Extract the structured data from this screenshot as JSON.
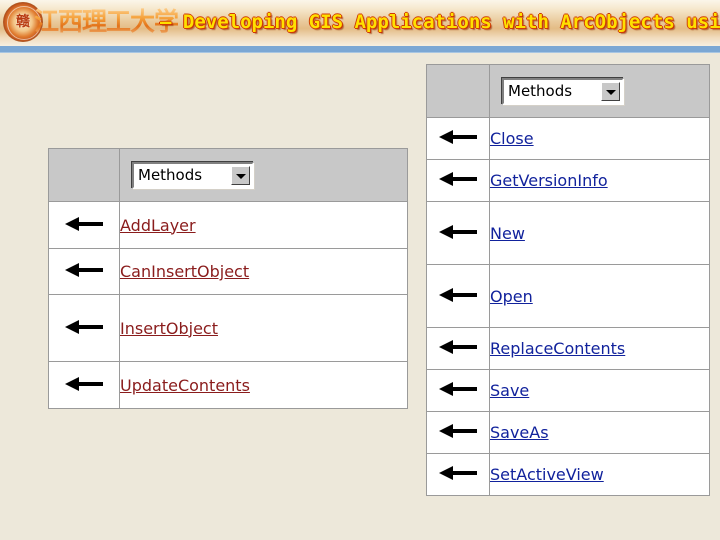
{
  "banner": {
    "logo_icon": "university-seal-icon",
    "logo_glyph": "赣",
    "university_cn": "江西理工大学",
    "course_title": "– Developing GIS Applications with ArcObjects using C#.NE",
    "rule_color": "#7ba7d4",
    "background_accent": "#e3bc86"
  },
  "page": {
    "background_color": "#ede8da"
  },
  "tables": [
    {
      "id": "left-methods-table",
      "dropdown_value": "Methods",
      "link_color": "#8a1c1c",
      "rows": [
        {
          "arrow_icon": "left-arrow-icon",
          "label": "AddLayer"
        },
        {
          "arrow_icon": "left-arrow-icon",
          "label": "CanInsertObject"
        },
        {
          "arrow_icon": "left-arrow-icon",
          "label": "InsertObject"
        },
        {
          "arrow_icon": "left-arrow-icon",
          "label": "UpdateContents"
        }
      ]
    },
    {
      "id": "right-methods-table",
      "dropdown_value": "Methods",
      "link_color": "#11229c",
      "rows": [
        {
          "arrow_icon": "left-arrow-icon",
          "label": "Close"
        },
        {
          "arrow_icon": "left-arrow-icon",
          "label": "GetVersionInfo"
        },
        {
          "arrow_icon": "left-arrow-icon",
          "label": "New"
        },
        {
          "arrow_icon": "left-arrow-icon",
          "label": "Open"
        },
        {
          "arrow_icon": "left-arrow-icon",
          "label": "ReplaceContents"
        },
        {
          "arrow_icon": "left-arrow-icon",
          "label": "Save"
        },
        {
          "arrow_icon": "left-arrow-icon",
          "label": "SaveAs"
        },
        {
          "arrow_icon": "left-arrow-icon",
          "label": "SetActiveView"
        }
      ]
    }
  ]
}
